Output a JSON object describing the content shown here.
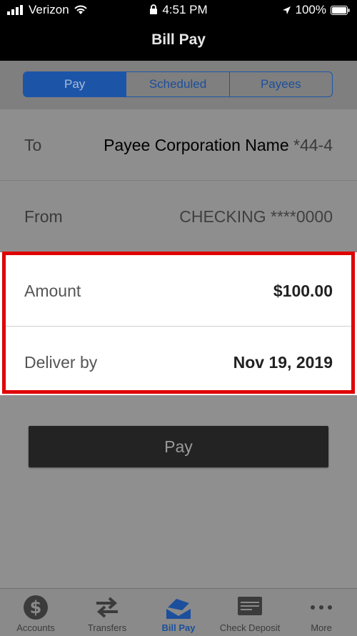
{
  "status": {
    "carrier": "Verizon",
    "time": "4:51 PM",
    "battery": "100%"
  },
  "header": {
    "title": "Bill Pay"
  },
  "segments": [
    {
      "label": "Pay"
    },
    {
      "label": "Scheduled"
    },
    {
      "label": "Payees"
    }
  ],
  "form": {
    "to_label": "To",
    "to_value": "Payee Corporation Name",
    "to_account": "*44-4",
    "from_label": "From",
    "from_value": "CHECKING",
    "from_account": "****0000",
    "amount_label": "Amount",
    "amount_value": "$100.00",
    "deliver_label": "Deliver by",
    "deliver_value": "Nov 19, 2019"
  },
  "pay_button": "Pay",
  "tabs": [
    {
      "label": "Accounts",
      "icon": "dollar-circle-icon"
    },
    {
      "label": "Transfers",
      "icon": "transfer-arrows-icon"
    },
    {
      "label": "Bill Pay",
      "icon": "bill-envelope-icon"
    },
    {
      "label": "Check Deposit",
      "icon": "check-card-icon"
    },
    {
      "label": "More",
      "icon": "more-dots-icon"
    }
  ],
  "colors": {
    "accent": "#1c55a8",
    "highlight": "#e00000"
  }
}
